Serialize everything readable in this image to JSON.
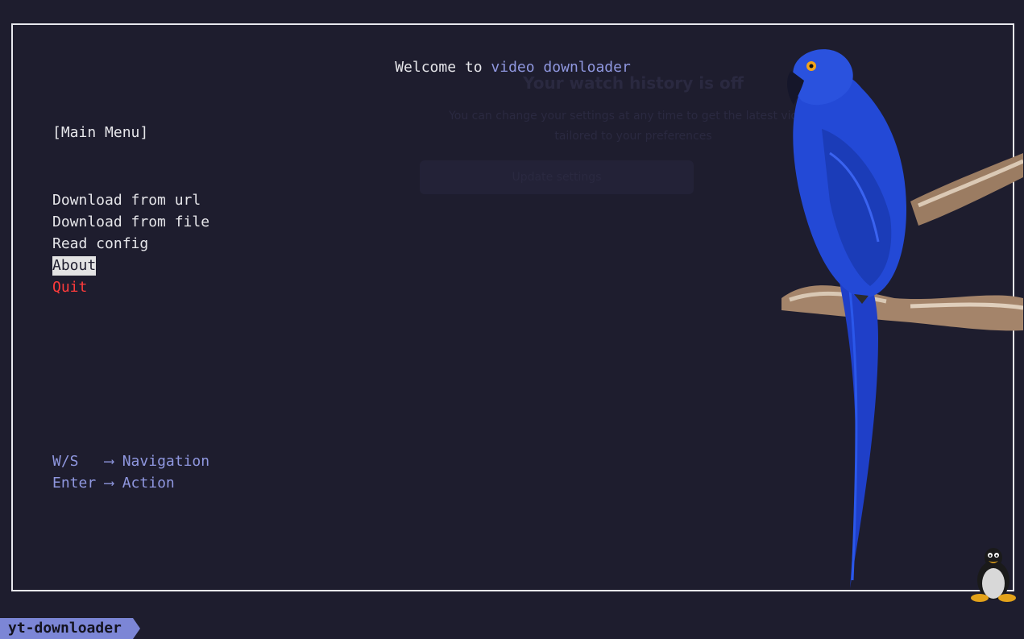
{
  "header": {
    "welcome_prefix": "Welcome to ",
    "app_name": "video downloader"
  },
  "menu": {
    "title": "[Main Menu]",
    "items": [
      {
        "label": "Download from url"
      },
      {
        "label": "Download from file"
      },
      {
        "label": "Read config"
      },
      {
        "label": "About",
        "selected": true
      },
      {
        "label": "Quit"
      }
    ]
  },
  "help": {
    "nav_key": "W/S",
    "nav_arrow": "⟶",
    "nav_action": "Navigation",
    "action_key": "Enter",
    "action_arrow": "⟶",
    "action_action": "Action"
  },
  "background_overlay": {
    "title": "Your watch history is off",
    "line1": "You can change your settings at any time to get the latest videos",
    "line2": "tailored to your preferences",
    "button": "Update settings"
  },
  "statusbar": {
    "label": "yt-downloader"
  },
  "colors": {
    "background": "#1e1d2e",
    "accent": "#8f97df",
    "quit": "#ff3b3b",
    "selected_bg": "#e3e3e3",
    "border": "#e8e8ee"
  },
  "icons": {
    "parrot": "hyacinth-macaw-image",
    "tux": "tux-penguin-icon"
  }
}
